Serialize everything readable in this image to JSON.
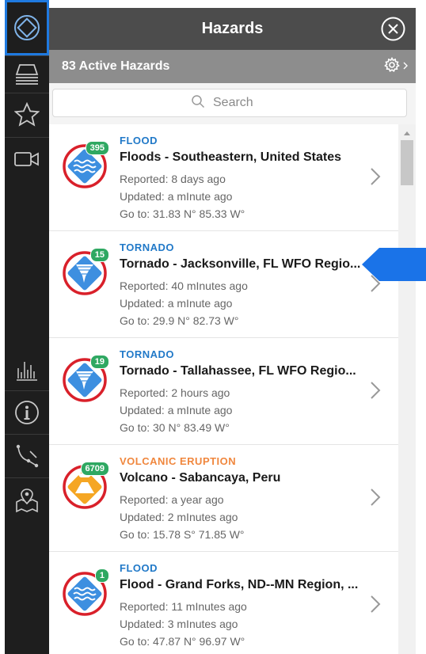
{
  "header": {
    "title": "Hazards"
  },
  "subheader": {
    "active_count": "83 Active Hazards"
  },
  "search": {
    "placeholder": "Search"
  },
  "colors": {
    "flood": "#2179c8",
    "volcanic": "#f0873e",
    "badge": "#2fa862",
    "highlight": "#1f7ae0"
  },
  "rail": {
    "items": [
      {
        "icon": "hazards-diamond-icon"
      },
      {
        "icon": "layers-icon"
      },
      {
        "icon": "star-icon"
      },
      {
        "icon": "video-camera-icon"
      },
      {
        "icon": "bar-chart-icon"
      },
      {
        "icon": "info-icon"
      },
      {
        "icon": "measure-path-icon"
      },
      {
        "icon": "map-pin-icon"
      }
    ]
  },
  "hazards": [
    {
      "category": "FLOOD",
      "title": "Floods - Southeastern, United States",
      "reported": "Reported: 8 days ago",
      "updated": "Updated: a mInute ago",
      "goto": "Go to: 31.83 N° 85.33 W°",
      "badge": "395",
      "icon": "flood-icon"
    },
    {
      "category": "TORNADO",
      "title": "Tornado - Jacksonville, FL WFO Regio...",
      "reported": "Reported: 40 mInutes ago",
      "updated": "Updated: a mInute ago",
      "goto": "Go to: 29.9 N° 82.73 W°",
      "badge": "15",
      "icon": "tornado-icon"
    },
    {
      "category": "TORNADO",
      "title": "Tornado - Tallahassee, FL WFO Regio...",
      "reported": "Reported: 2 hours ago",
      "updated": "Updated: a mInute ago",
      "goto": "Go to: 30 N° 83.49 W°",
      "badge": "19",
      "icon": "tornado-icon"
    },
    {
      "category": "VOLCANIC ERUPTION",
      "title": "Volcano - Sabancaya, Peru",
      "reported": "Reported: a year ago",
      "updated": "Updated: 2 mInutes ago",
      "goto": "Go to: 15.78 S° 71.85 W°",
      "badge": "6709",
      "icon": "volcano-icon"
    },
    {
      "category": "FLOOD",
      "title": "Flood - Grand Forks, ND--MN Region, ...",
      "reported": "Reported: 11 mInutes ago",
      "updated": "Updated: 3 mInutes ago",
      "goto": "Go to: 47.87 N° 96.97 W°",
      "badge": "1",
      "icon": "flood-icon"
    }
  ]
}
